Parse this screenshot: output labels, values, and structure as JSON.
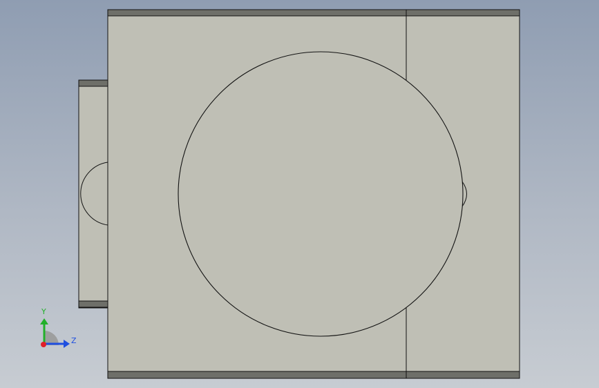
{
  "viewport": {
    "view": "Right",
    "colors": {
      "background_top": "#8f9db2",
      "background_bottom": "#c7ccd2",
      "face": "#bfbfb5",
      "edge": "#111111",
      "flange": "#6e6f69"
    }
  },
  "triad": {
    "y_label": "Y",
    "z_label": "Z",
    "y_color": "#22b02a",
    "z_color": "#1f4fe0",
    "x_color": "#e0202a"
  }
}
